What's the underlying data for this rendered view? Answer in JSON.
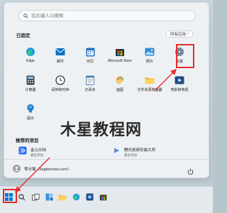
{
  "search": {
    "placeholder": "在此键入以搜索"
  },
  "pinned": {
    "title": "已固定",
    "all_apps_label": "所有应用",
    "apps": [
      {
        "label": "Edge",
        "icon": "edge-icon"
      },
      {
        "label": "邮件",
        "icon": "mail-icon"
      },
      {
        "label": "日历",
        "icon": "calendar-icon"
      },
      {
        "label": "Microsoft Store",
        "icon": "store-icon"
      },
      {
        "label": "照片",
        "icon": "photos-icon"
      },
      {
        "label": "设置",
        "icon": "gear-icon"
      },
      {
        "label": "计算器",
        "icon": "calculator-icon"
      },
      {
        "label": "闹钟和时钟",
        "icon": "clock-icon"
      },
      {
        "label": "记事本",
        "icon": "notepad-icon"
      },
      {
        "label": "画图",
        "icon": "paint-icon"
      },
      {
        "label": "文件资源管理器",
        "icon": "folder-icon"
      },
      {
        "label": "电影和电视",
        "icon": "movies-icon"
      },
      {
        "label": "提示",
        "icon": "tips-icon"
      }
    ]
  },
  "watermark": "木星教程网",
  "recommended": {
    "title": "推荐的项目",
    "items": [
      {
        "name": "金山文档",
        "sub": "最近添加",
        "icon": "kdocs-icon"
      },
      {
        "name": "腾讯视频安装大师",
        "sub": "最近添加",
        "icon": "tencent-video-icon"
      }
    ]
  },
  "user": {
    "name": "零分猫（lingfenmao.com）"
  },
  "colors": {
    "highlight": "#e52b2b",
    "accent": "#0078d4"
  }
}
